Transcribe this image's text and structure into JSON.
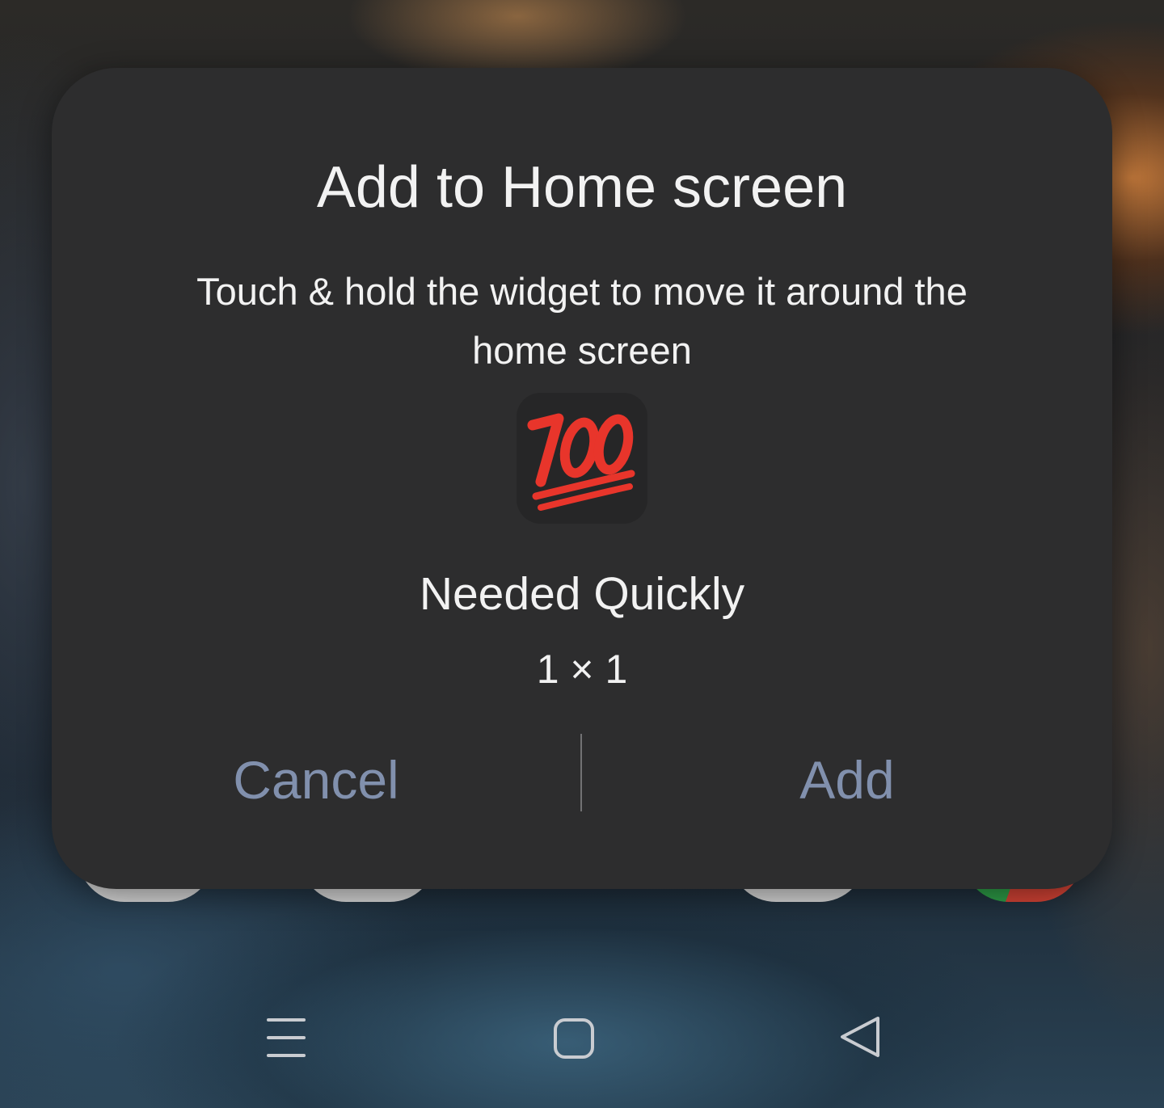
{
  "dialog": {
    "title": "Add to Home screen",
    "message": "Touch & hold the widget to move it around the home screen",
    "widget": {
      "icon": "hundred-points-emoji-icon",
      "name": "Needed Quickly",
      "size": "1 × 1"
    },
    "buttons": {
      "cancel_label": "Cancel",
      "add_label": "Add"
    },
    "colors": {
      "surface": "#2d2d2e",
      "text": "#f2f2f2",
      "button_text": "#8190ad",
      "emoji_red": "#e8352b"
    }
  },
  "navbar": {
    "recents_icon": "recents-icon",
    "home_icon": "home-icon",
    "back_icon": "back-icon"
  }
}
